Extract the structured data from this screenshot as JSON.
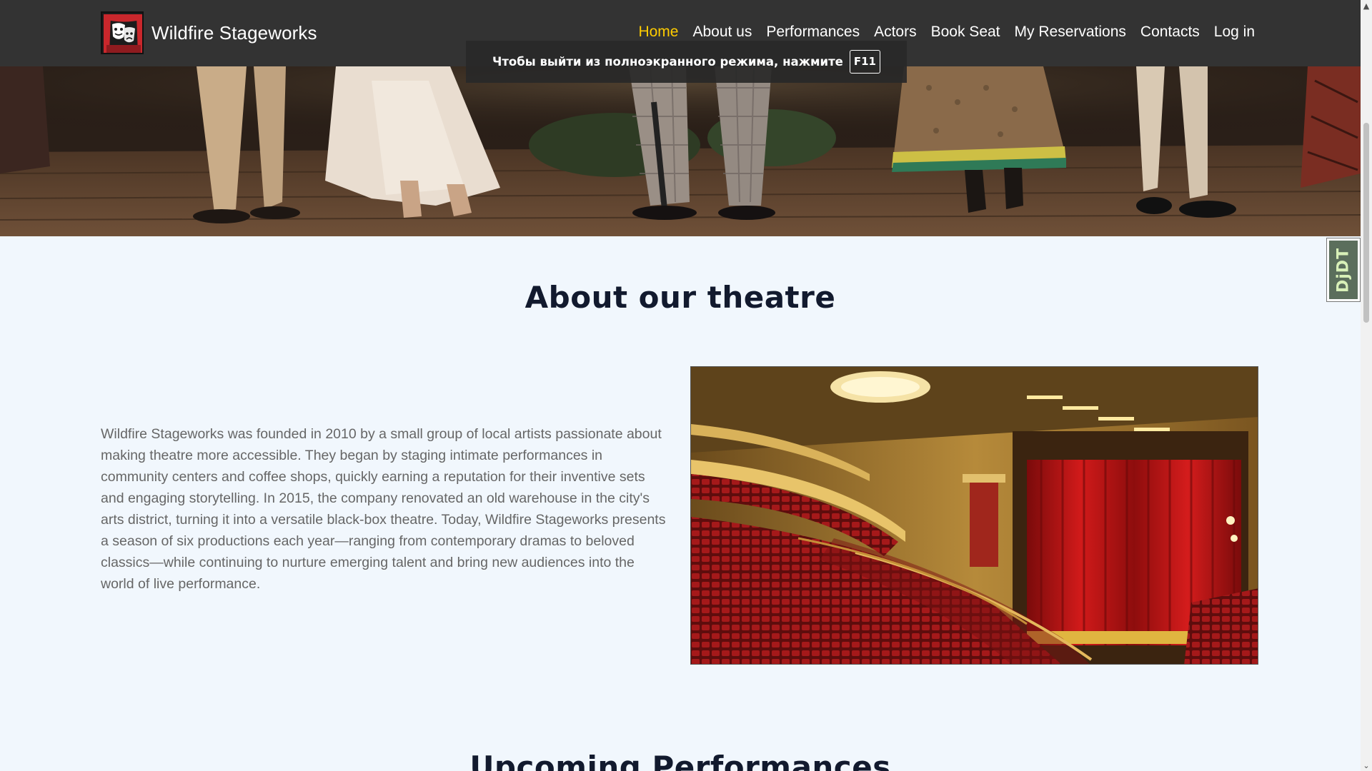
{
  "brand": {
    "name": "Wildfire Stageworks",
    "logo_icon": "theatre-masks-icon"
  },
  "nav": {
    "items": [
      {
        "label": "Home",
        "active": true
      },
      {
        "label": "About us",
        "active": false
      },
      {
        "label": "Performances",
        "active": false
      },
      {
        "label": "Actors",
        "active": false
      },
      {
        "label": "Book Seat",
        "active": false
      },
      {
        "label": "My Reservations",
        "active": false
      },
      {
        "label": "Contacts",
        "active": false
      },
      {
        "label": "Log in",
        "active": false
      }
    ],
    "active_color": "#ffcc00"
  },
  "fullscreen_toast": {
    "text": "Чтобы выйти из полноэкранного режима, нажмите",
    "key": "F11"
  },
  "about": {
    "title": "About our theatre",
    "body": "Wildfire Stageworks was founded in 2010 by a small group of local artists passionate about making theatre more accessible. They began by staging intimate performances in community centers and coffee shops, quickly earning a reputation for their inventive sets and engaging storytelling. In 2015, the company renovated an old warehouse in the city's arts district, turning it into a versatile black-box theatre. Today, Wildfire Stageworks presents a season of six productions each year—ranging from contemporary dramas to beloved classics—while continuing to nurture emerging talent and bring new audiences into the world of live performance."
  },
  "upcoming": {
    "title": "Upcoming Performances"
  },
  "debug_toolbar": {
    "label": "DjDT"
  },
  "colors": {
    "navbar": "#333333",
    "page_bg": "#f1f7fd",
    "heading": "#121a2e",
    "body_text": "#666666"
  }
}
